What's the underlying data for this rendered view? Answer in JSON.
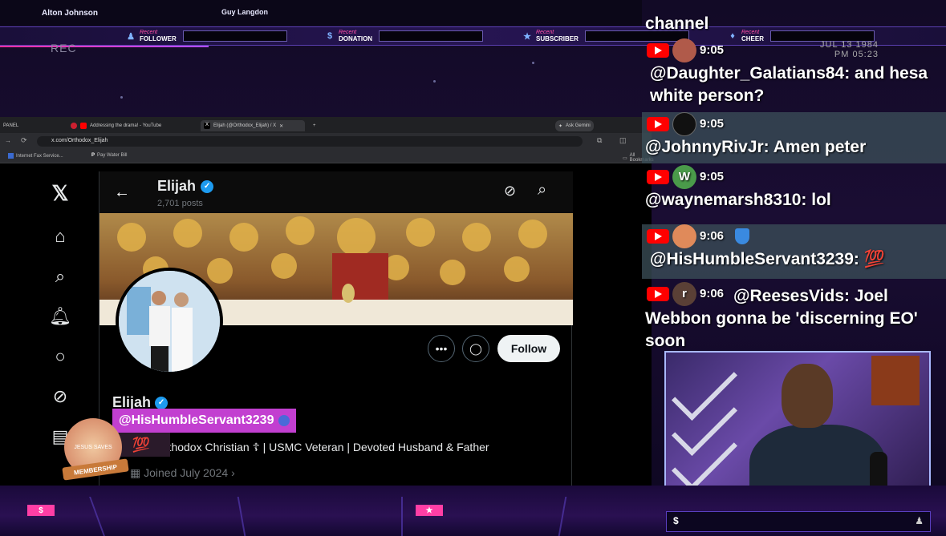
{
  "overlay": {
    "names": [
      "Alton Johnson",
      "Guy Langdon"
    ],
    "stats": [
      {
        "label": "FOLLOWER",
        "tag": "Recent",
        "icon": "person-icon"
      },
      {
        "label": "DONATION",
        "tag": "Recent",
        "icon": "dollar-icon"
      },
      {
        "label": "SUBSCRIBER",
        "tag": "Recent",
        "icon": "star-icon"
      },
      {
        "label": "CHEER",
        "tag": "Recent",
        "icon": "gem-icon"
      }
    ],
    "rec": "REC",
    "clock_date": "JUL 13 1984",
    "clock_time": "PM 05:23",
    "membership": "MEMBERSHIP",
    "membership_text": "JESUS SAVES",
    "shoutout_handle": "@HisHumbleServant3239",
    "shoutout_extra": "💯",
    "bottom_left_badge": "$",
    "bottom_mid_badge": "★",
    "bottom_right_badge": "$"
  },
  "browser": {
    "tabs": [
      {
        "label": "PANEL"
      },
      {
        "label": "Addressing the drama! - YouTube"
      },
      {
        "label": "Elijah (@Orthodox_Elijah) / X"
      }
    ],
    "ask": "Ask Gemini",
    "url": "x.com/Orthodox_Elijah",
    "bookmarks": [
      "Internet Fax Service...",
      "Pay Water Bill",
      "All Bookmarks"
    ]
  },
  "profile": {
    "name": "Elijah",
    "posts": "2,701 posts",
    "follow": "Follow",
    "bio": "Orthodox Christian ☦ | USMC Veteran | Devoted Husband & Father",
    "joined": "Joined July 2024"
  },
  "chat": {
    "top_line": "channel",
    "messages": [
      {
        "time": "9:05",
        "text": "@Daughter_Galatians84: and hesa white person?"
      },
      {
        "time": "9:05",
        "text": "@JohnnyRivJr: Amen peter"
      },
      {
        "time": "9:05",
        "avatar": "W",
        "text": "@waynemarsh8310: lol"
      },
      {
        "time": "9:06",
        "text": "@HisHumbleServant3239: 💯"
      },
      {
        "time": "9:06",
        "avatar": "r",
        "text": "@ReesesVids: Joel Webbon gonna be 'discerning EO' soon"
      }
    ]
  }
}
